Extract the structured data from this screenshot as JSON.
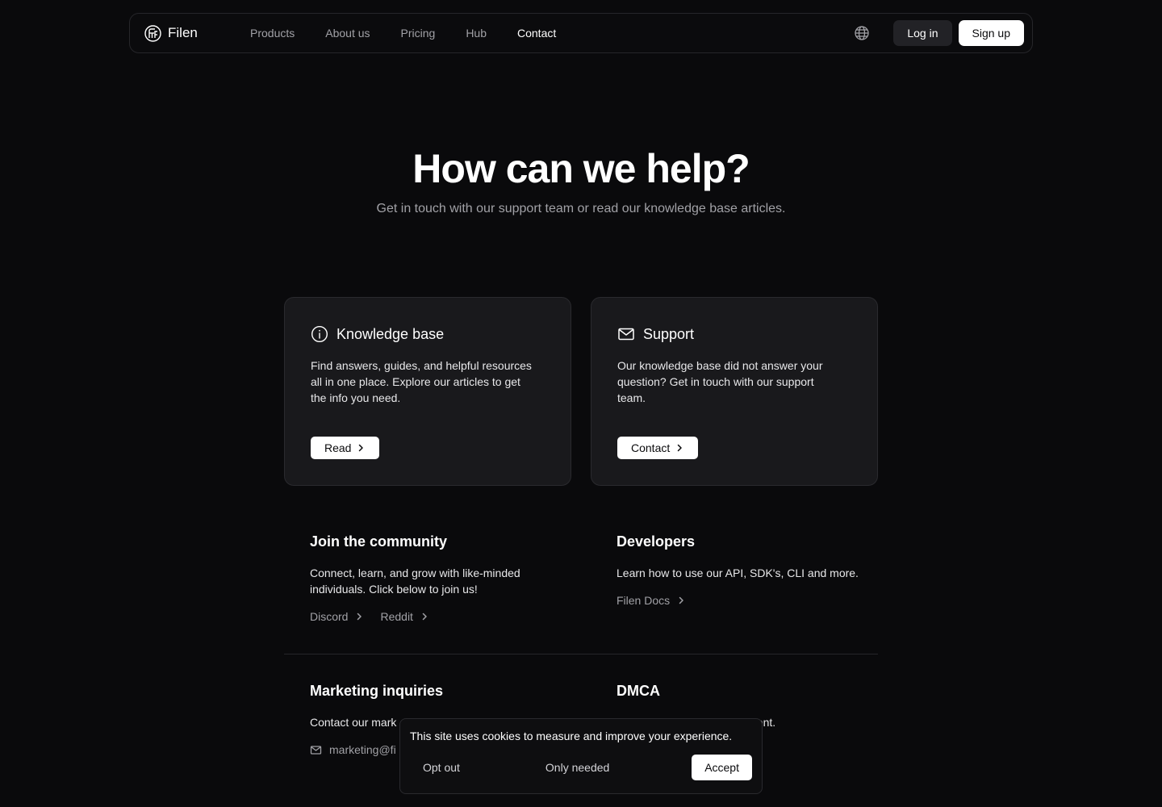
{
  "nav": {
    "brand": "Filen",
    "links": [
      {
        "label": "Products"
      },
      {
        "label": "About us"
      },
      {
        "label": "Pricing"
      },
      {
        "label": "Hub"
      },
      {
        "label": "Contact"
      }
    ],
    "active_link": "Contact",
    "login": "Log in",
    "signup": "Sign up"
  },
  "hero": {
    "title": "How can we help?",
    "subtitle": "Get in touch with our support team or read our knowledge base articles."
  },
  "cards": [
    {
      "icon": "info-icon",
      "title": "Knowledge base",
      "text": "Find answers, guides, and helpful resources all in one place. Explore our articles to get the info you need.",
      "button": "Read"
    },
    {
      "icon": "mail-icon",
      "title": "Support",
      "text": "Our knowledge base did not answer your question? Get in touch with our support team.",
      "button": "Contact"
    }
  ],
  "community": {
    "title": "Join the community",
    "text": "Connect, learn, and grow with like-minded individuals. Click below to join us!",
    "links": [
      "Discord",
      "Reddit"
    ]
  },
  "developers": {
    "title": "Developers",
    "text": "Learn how to use our API, SDK's, CLI and more.",
    "links": [
      "Filen Docs"
    ]
  },
  "marketing": {
    "title": "Marketing inquiries",
    "text_visible": "Contact our mark",
    "email_visible": "marketing@fi"
  },
  "dmca": {
    "title": "DMCA",
    "text_visible": "nent."
  },
  "cookie": {
    "message": "This site uses cookies to measure and improve your experience.",
    "opt_out": "Opt out",
    "only_needed": "Only needed",
    "accept": "Accept"
  },
  "colors": {
    "background": "#0a0a0c",
    "card": "#19191c",
    "muted_text": "#a1a1a6",
    "button_light": "#ffffff"
  }
}
